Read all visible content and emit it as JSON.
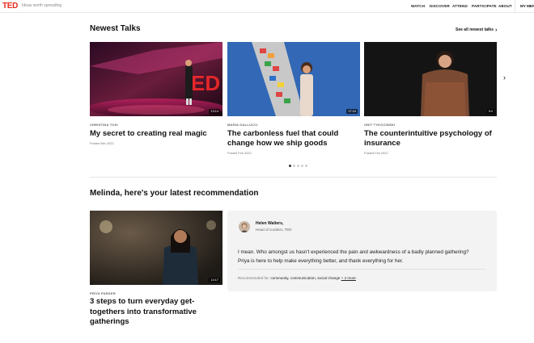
{
  "header": {
    "logo": "TED",
    "tagline": "Ideas worth spreading",
    "nav": [
      "WATCH",
      "DISCOVER",
      "ATTEND",
      "PARTICIPATE",
      "ABOUT"
    ],
    "my_menu": "MY MENU"
  },
  "newest": {
    "title": "Newest Talks",
    "see_all": "See all newest talks",
    "talks": [
      {
        "speaker": "CHRISTINA TOSI",
        "title": "My secret to creating real magic",
        "posted": "Posted Mar 2022",
        "duration": "13:14"
      },
      {
        "speaker": "MARIA GALLUCCI",
        "title": "The carbonless fuel that could change how we ship goods",
        "posted": "Posted Feb 2022",
        "duration": "07:19"
      },
      {
        "speaker": "ORIT TYKOCINSKI",
        "title": "The counterintuitive psychology of insurance",
        "posted": "Posted Feb 2022",
        "duration": "9:0"
      }
    ],
    "page_count": 5,
    "active_page": 1
  },
  "recommendation": {
    "title": "Melinda, here's your latest recommendation",
    "talk": {
      "speaker": "PRIYA PARKER",
      "title": "3 steps to turn everyday get-togethers into transformative gatherings",
      "duration": "14:17"
    },
    "curator": {
      "name": "Helen Walters,",
      "role": "Head of curation, TED"
    },
    "quote": "I mean. Who amongst us hasn't experienced the pain and awkwardness of a badly planned gathering? Priya is here to help make everything better, and thank everything for her.",
    "recommended_for_label": "Recommended for:",
    "tags": "community, communication, social change",
    "more": "+ 2 more"
  }
}
